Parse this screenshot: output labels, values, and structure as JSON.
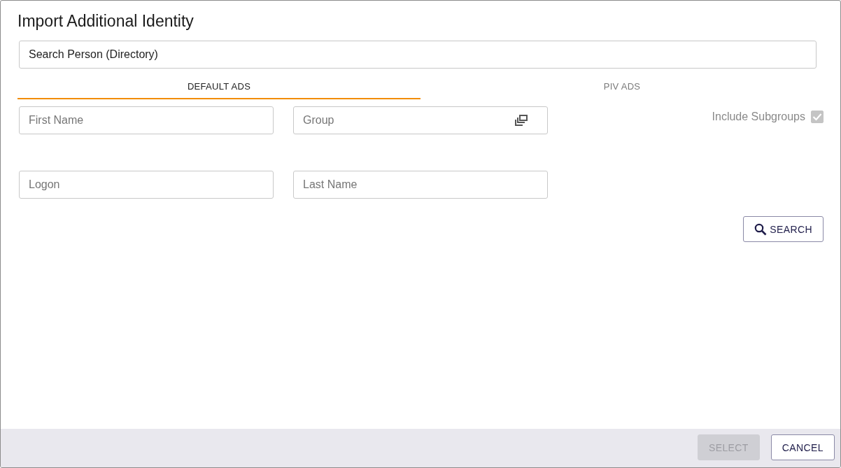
{
  "window": {
    "title": "Import Additional Identity"
  },
  "directory_search": {
    "value": "Search Person (Directory)"
  },
  "tabs": [
    {
      "label": "DEFAULT ADS",
      "selected": true
    },
    {
      "label": "PIV ADS",
      "selected": false
    }
  ],
  "fields": [
    {
      "placeholder": "First Name",
      "kind": "text"
    },
    {
      "placeholder": "Group",
      "kind": "picker"
    },
    {
      "placeholder": "Logon",
      "kind": "text"
    },
    {
      "placeholder": "Last Name",
      "kind": "text"
    }
  ],
  "include_subgroups": {
    "label": "Include Subgroups",
    "checked": true,
    "disabled": true
  },
  "search_button": {
    "label": "SEARCH"
  },
  "footer_buttons": [
    {
      "label": "SELECT",
      "disabled": true
    },
    {
      "label": "CANCEL",
      "disabled": false
    }
  ]
}
